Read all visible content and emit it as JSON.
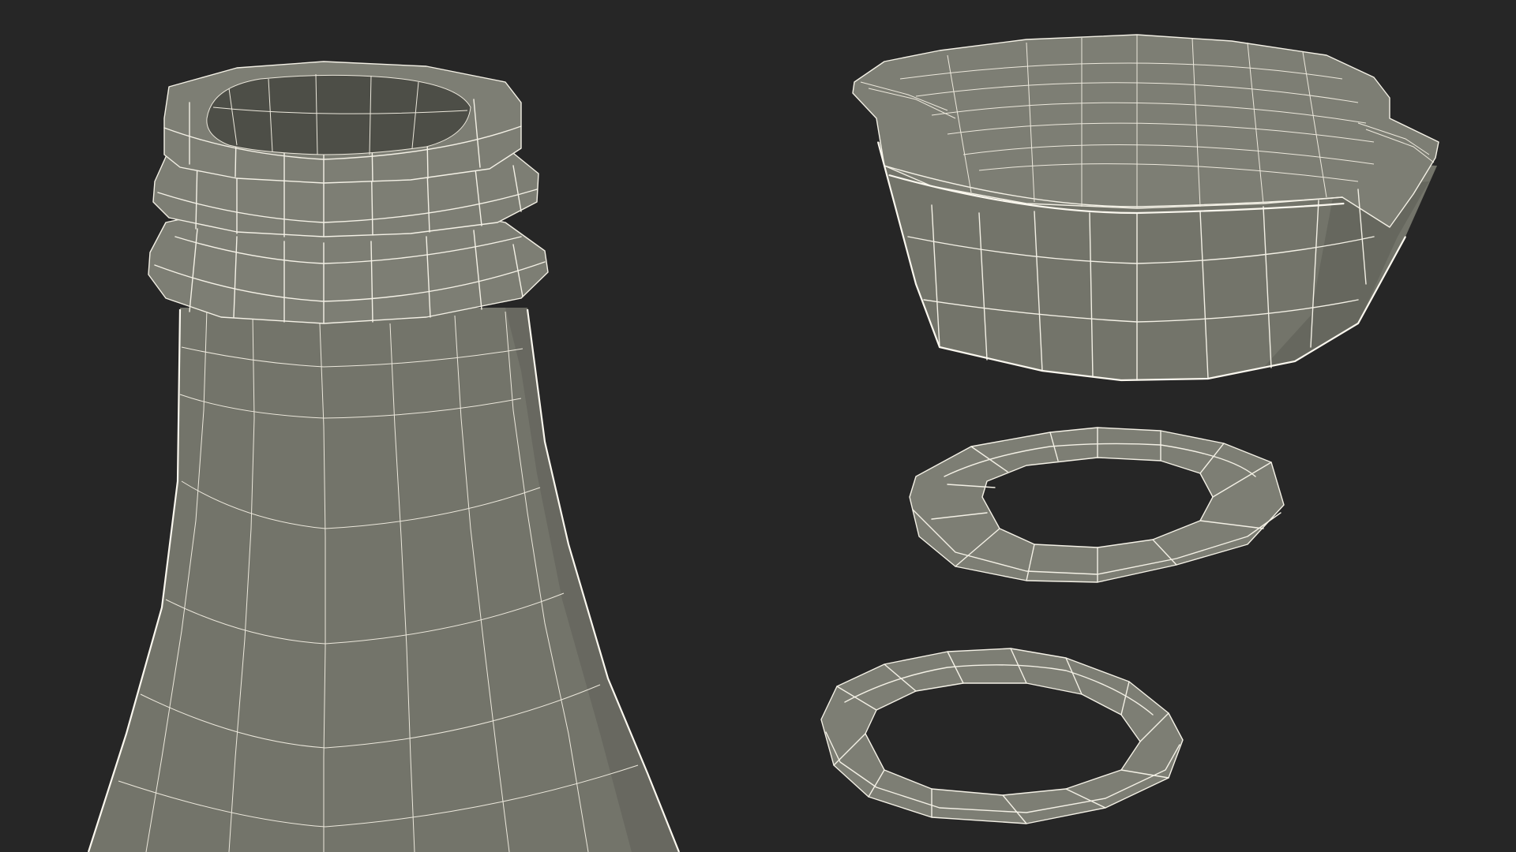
{
  "scene": {
    "background": "#262626",
    "surface_color": "#73746a",
    "wire_color": "#f4f1e6",
    "objects": [
      {
        "name": "bottle-neck",
        "kind": "wireframe-mesh"
      },
      {
        "name": "bottle-cap",
        "kind": "wireframe-mesh"
      },
      {
        "name": "gasket-ring-upper",
        "kind": "wireframe-mesh"
      },
      {
        "name": "gasket-ring-lower",
        "kind": "wireframe-mesh"
      }
    ]
  }
}
